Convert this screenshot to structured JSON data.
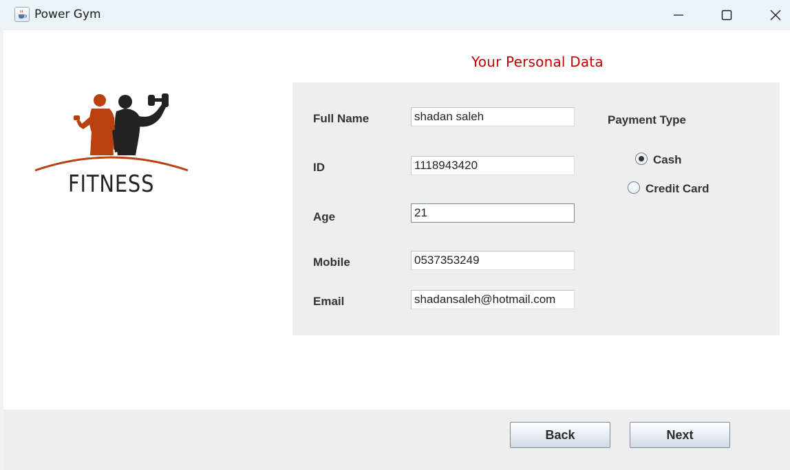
{
  "window": {
    "title": "Power Gym"
  },
  "header": {
    "section_title": "Your Personal Data"
  },
  "logo": {
    "text": "FITNESS"
  },
  "form": {
    "fields": [
      {
        "label": "Full Name",
        "value": "shadan saleh"
      },
      {
        "label": "ID",
        "value": "1118943420"
      },
      {
        "label": "Age",
        "value": "21"
      },
      {
        "label": "Mobile",
        "value": "0537353249"
      },
      {
        "label": "Email",
        "value": "shadansaleh@hotmail.com"
      }
    ]
  },
  "payment": {
    "label": "Payment Type",
    "options": [
      {
        "label": "Cash",
        "selected": true
      },
      {
        "label": "Credit Card",
        "selected": false
      }
    ]
  },
  "buttons": {
    "back": "Back",
    "next": "Next"
  },
  "colors": {
    "accent_title": "#c00000",
    "panel": "#eeeeee",
    "titlebar": "#eaf3f7"
  },
  "icons": {
    "app": "java-cup-icon",
    "minimize": "minimize-icon",
    "maximize": "maximize-icon",
    "close": "close-icon"
  }
}
